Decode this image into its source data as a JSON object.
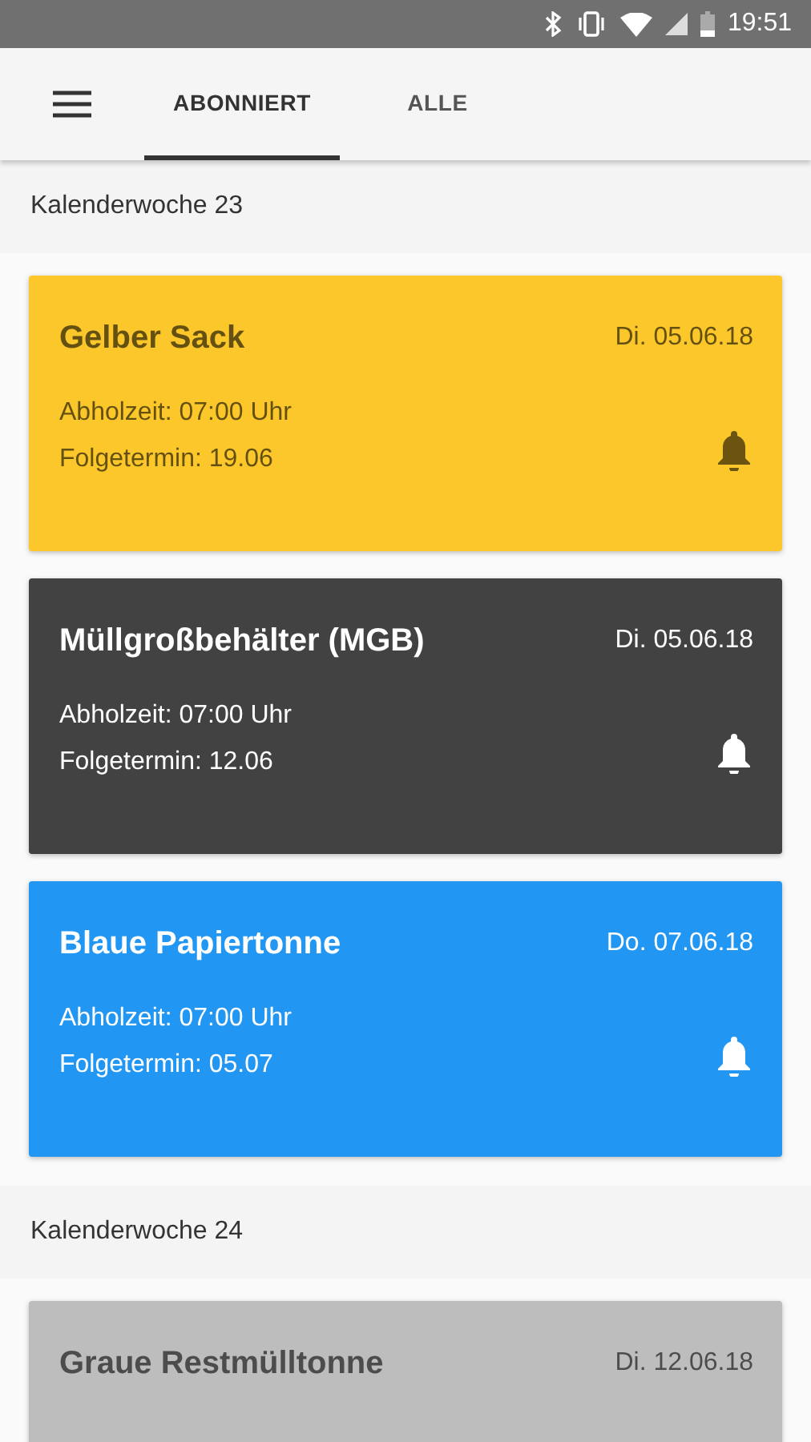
{
  "status_bar": {
    "time": "19:51"
  },
  "tabs": [
    {
      "label": "ABONNIERT",
      "selected": true
    },
    {
      "label": "ALLE",
      "selected": false
    }
  ],
  "weeks": [
    {
      "title": "Kalenderwoche 23",
      "cards": [
        {
          "name": "Gelber Sack",
          "date": "Di. 05.06.18",
          "color": "#fbc72a",
          "lines": [
            "Abholzeit: 07:00 Uhr",
            "Folgetermin: 19.06"
          ]
        },
        {
          "name": "Müllgroßbehälter (MGB)",
          "date": "Di. 05.06.18",
          "color": "#424242",
          "lines": [
            "Abholzeit: 07:00 Uhr",
            "Folgetermin: 12.06"
          ]
        },
        {
          "name": "Blaue Papiertonne",
          "date": "Do. 07.06.18",
          "color": "#2196f3",
          "lines": [
            "Abholzeit: 07:00 Uhr",
            "Folgetermin: 05.07"
          ]
        }
      ]
    },
    {
      "title": "Kalenderwoche 24",
      "cards": [
        {
          "name": "Graue Restmülltonne",
          "date": "Di. 12.06.18",
          "color": "#bdbdbd"
        }
      ]
    }
  ]
}
